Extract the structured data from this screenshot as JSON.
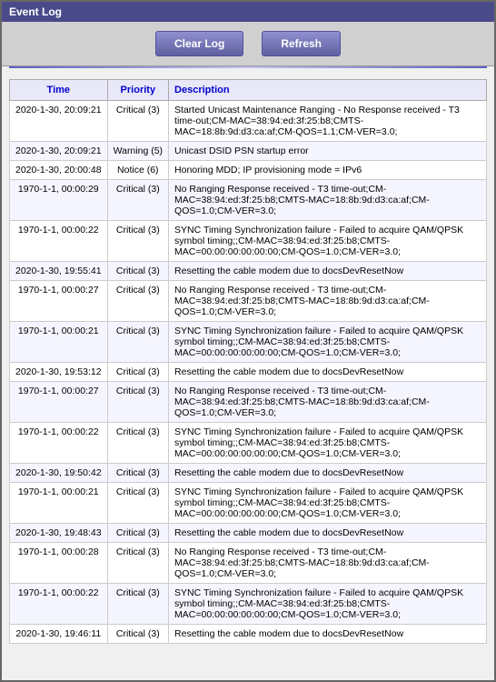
{
  "window": {
    "title": "Event Log"
  },
  "toolbar": {
    "clear_label": "Clear Log",
    "refresh_label": "Refresh"
  },
  "table": {
    "headers": [
      "Time",
      "Priority",
      "Description"
    ],
    "rows": [
      {
        "time": "2020-1-30, 20:09:21",
        "priority": "Critical (3)",
        "description": "Started Unicast Maintenance Ranging - No Response received - T3 time-out;CM-MAC=38:94:ed:3f:25:b8;CMTS-MAC=18:8b:9d:d3:ca:af;CM-QOS=1.1;CM-VER=3.0;"
      },
      {
        "time": "2020-1-30, 20:09:21",
        "priority": "Warning (5)",
        "description": "Unicast DSID PSN startup error"
      },
      {
        "time": "2020-1-30, 20:00:48",
        "priority": "Notice (6)",
        "description": "Honoring MDD; IP provisioning mode = IPv6"
      },
      {
        "time": "1970-1-1, 00:00:29",
        "priority": "Critical (3)",
        "description": "No Ranging Response received - T3 time-out;CM-MAC=38:94:ed:3f:25:b8;CMTS-MAC=18:8b:9d:d3:ca:af;CM-QOS=1.0;CM-VER=3.0;"
      },
      {
        "time": "1970-1-1, 00:00:22",
        "priority": "Critical (3)",
        "description": "SYNC Timing Synchronization failure - Failed to acquire QAM/QPSK symbol timing;;CM-MAC=38:94:ed:3f:25:b8;CMTS-MAC=00:00:00:00:00:00;CM-QOS=1.0;CM-VER=3.0;"
      },
      {
        "time": "2020-1-30, 19:55:41",
        "priority": "Critical (3)",
        "description": "Resetting the cable modem due to docsDevResetNow"
      },
      {
        "time": "1970-1-1, 00:00:27",
        "priority": "Critical (3)",
        "description": "No Ranging Response received - T3 time-out;CM-MAC=38:94:ed:3f:25:b8;CMTS-MAC=18:8b:9d:d3:ca:af;CM-QOS=1.0;CM-VER=3.0;"
      },
      {
        "time": "1970-1-1, 00:00:21",
        "priority": "Critical (3)",
        "description": "SYNC Timing Synchronization failure - Failed to acquire QAM/QPSK symbol timing;;CM-MAC=38:94:ed:3f:25:b8;CMTS-MAC=00:00:00:00:00:00;CM-QOS=1.0;CM-VER=3.0;"
      },
      {
        "time": "2020-1-30, 19:53:12",
        "priority": "Critical (3)",
        "description": "Resetting the cable modem due to docsDevResetNow"
      },
      {
        "time": "1970-1-1, 00:00:27",
        "priority": "Critical (3)",
        "description": "No Ranging Response received - T3 time-out;CM-MAC=38:94:ed:3f:25:b8;CMTS-MAC=18:8b:9d:d3:ca:af;CM-QOS=1.0;CM-VER=3.0;"
      },
      {
        "time": "1970-1-1, 00:00:22",
        "priority": "Critical (3)",
        "description": "SYNC Timing Synchronization failure - Failed to acquire QAM/QPSK symbol timing;;CM-MAC=38:94:ed:3f:25:b8;CMTS-MAC=00:00:00:00:00:00;CM-QOS=1.0;CM-VER=3.0;"
      },
      {
        "time": "2020-1-30, 19:50:42",
        "priority": "Critical (3)",
        "description": "Resetting the cable modem due to docsDevResetNow"
      },
      {
        "time": "1970-1-1, 00:00:21",
        "priority": "Critical (3)",
        "description": "SYNC Timing Synchronization failure - Failed to acquire QAM/QPSK symbol timing;;CM-MAC=38:94:ed:3f:25:b8;CMTS-MAC=00:00:00:00:00:00;CM-QOS=1.0;CM-VER=3.0;"
      },
      {
        "time": "2020-1-30, 19:48:43",
        "priority": "Critical (3)",
        "description": "Resetting the cable modem due to docsDevResetNow"
      },
      {
        "time": "1970-1-1, 00:00:28",
        "priority": "Critical (3)",
        "description": "No Ranging Response received - T3 time-out;CM-MAC=38:94:ed:3f:25:b8;CMTS-MAC=18:8b:9d:d3:ca:af;CM-QOS=1.0;CM-VER=3.0;"
      },
      {
        "time": "1970-1-1, 00:00:22",
        "priority": "Critical (3)",
        "description": "SYNC Timing Synchronization failure - Failed to acquire QAM/QPSK symbol timing;;CM-MAC=38:94:ed:3f:25:b8;CMTS-MAC=00:00:00:00:00:00;CM-QOS=1.0;CM-VER=3.0;"
      },
      {
        "time": "2020-1-30, 19:46:11",
        "priority": "Critical (3)",
        "description": "Resetting the cable modem due to docsDevResetNow"
      }
    ]
  }
}
